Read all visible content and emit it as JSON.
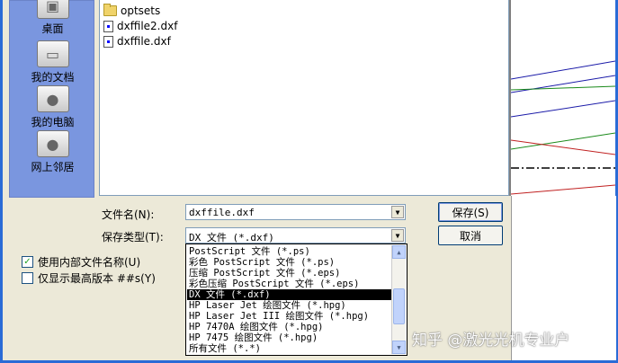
{
  "places": [
    {
      "label": "桌面",
      "icon": "desktop-icon"
    },
    {
      "label": "我的文档",
      "icon": "my-documents-icon"
    },
    {
      "label": "我的电脑",
      "icon": "my-computer-icon"
    },
    {
      "label": "网上邻居",
      "icon": "network-icon"
    }
  ],
  "files": [
    {
      "name": "optsets",
      "type": "folder"
    },
    {
      "name": "dxffile2.dxf",
      "type": "dxf"
    },
    {
      "name": "dxffile.dxf",
      "type": "dxf"
    }
  ],
  "form": {
    "filename_label": "文件名(N):",
    "filename_value": "dxffile.dxf",
    "filetype_label": "保存类型(T):",
    "filetype_value": "DX 文件 (*.dxf)",
    "save_button": "保存(S)",
    "cancel_button": "取消"
  },
  "options": [
    {
      "label": "使用内部文件名称(U)",
      "checked": true
    },
    {
      "label": "仅显示最高版本 ##s(Y)",
      "checked": false
    }
  ],
  "filetype_options": [
    "PostScript 文件 (*.ps)",
    "彩色 PostScript 文件 (*.ps)",
    "压缩 PostScript 文件 (*.eps)",
    "彩色压缩 PostScript 文件 (*.eps)",
    "DX 文件 (*.dxf)",
    "HP Laser Jet 绘图文件 (*.hpg)",
    "HP Laser Jet III 绘图文件 (*.hpg)",
    "HP 7470A 绘图文件 (*.hpg)",
    "HP 7475 绘图文件 (*.hpg)",
    "所有文件 (*.*)"
  ],
  "selected_option_index": 4,
  "watermark": "知乎 @激光光机专业户",
  "colors": {
    "dialog_bg": "#ece9d8",
    "places_bg": "#7a96df",
    "frame_blue": "#2a6bd6"
  }
}
